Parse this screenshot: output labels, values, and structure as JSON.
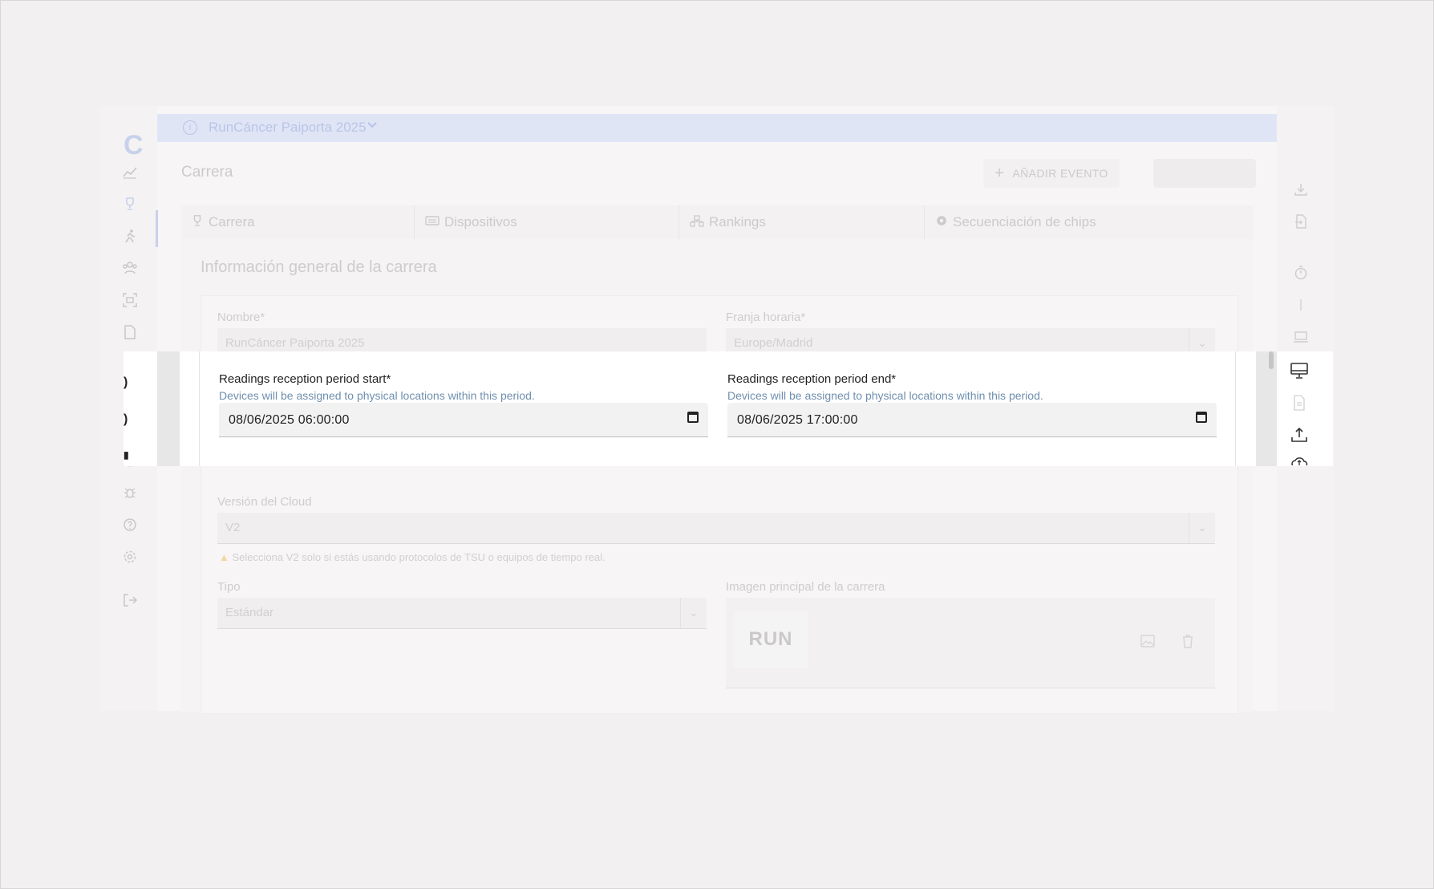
{
  "app": {
    "race_selector": {
      "name": "RunCáncer Paiporta 2025"
    },
    "page_title": "Carrera",
    "toolbar": {
      "add_event_label": "AÑADIR EVENTO",
      "export_label": ""
    },
    "tabs": [
      {
        "label": "Carrera",
        "icon": "trophy-icon"
      },
      {
        "label": "Dispositivos",
        "icon": "devices-icon"
      },
      {
        "label": "Rankings",
        "icon": "rankings-icon"
      },
      {
        "label": "Secuenciación de chips",
        "icon": "gear-icon"
      }
    ],
    "section_title": "Información general de la carrera",
    "form": {
      "name": {
        "label": "Nombre*",
        "value": "RunCáncer Paiporta 2025"
      },
      "timezone": {
        "label": "Franja horaria*",
        "value": "Europe/Madrid"
      },
      "readings_start": {
        "label": "Readings reception period start*",
        "help": "Devices will be assigned to physical locations within this period.",
        "value": "08/06/2025 06:00:00"
      },
      "readings_end": {
        "label": "Readings reception period end*",
        "help": "Devices will be assigned to physical locations within this period.",
        "value": "08/06/2025 17:00:00"
      },
      "cloud_version": {
        "label": "Versión del Cloud",
        "value": "V2",
        "warning": "Selecciona V2 solo si estás usando protocolos de TSU o equipos de tiempo real."
      },
      "type": {
        "label": "Tipo",
        "value": "Estándar"
      },
      "main_image": {
        "label": "Imagen principal de la carrera",
        "logo_text": "RUN"
      }
    }
  },
  "sidebar_left": {
    "logo": "C",
    "items": [
      {
        "name": "dashboard",
        "icon": "chart-icon"
      },
      {
        "name": "races",
        "icon": "trophy-icon"
      },
      {
        "name": "runners",
        "icon": "runner-icon"
      },
      {
        "name": "participants",
        "icon": "people-icon"
      },
      {
        "name": "scanner",
        "icon": "scan-icon"
      },
      {
        "name": "documents",
        "icon": "document-icon"
      },
      {
        "name": "timing",
        "icon": "clock-icon"
      },
      {
        "name": "cards",
        "icon": "cards-icon"
      },
      {
        "name": "blocked",
        "icon": "block-icon"
      },
      {
        "name": "sync",
        "icon": "sync-icon"
      },
      {
        "name": "debug",
        "icon": "bug-icon"
      },
      {
        "name": "help",
        "icon": "help-icon"
      },
      {
        "name": "settings",
        "icon": "gear-icon"
      },
      {
        "name": "logout",
        "icon": "logout-icon"
      }
    ]
  },
  "sidebar_right": {
    "items": [
      {
        "name": "download",
        "icon": "download-icon"
      },
      {
        "name": "import",
        "icon": "file-import-icon"
      },
      {
        "name": "stopwatch",
        "icon": "stopwatch-icon"
      },
      {
        "name": "laptop",
        "icon": "laptop-icon"
      },
      {
        "name": "monitor",
        "icon": "monitor-icon"
      },
      {
        "name": "file",
        "icon": "file-icon"
      },
      {
        "name": "upload",
        "icon": "upload-icon"
      },
      {
        "name": "cloud",
        "icon": "cloud-icon"
      }
    ]
  },
  "colors": {
    "accent": "#2f5fd0",
    "help_text": "#6f8fae",
    "overlay_bg": "#f2f0f1"
  }
}
